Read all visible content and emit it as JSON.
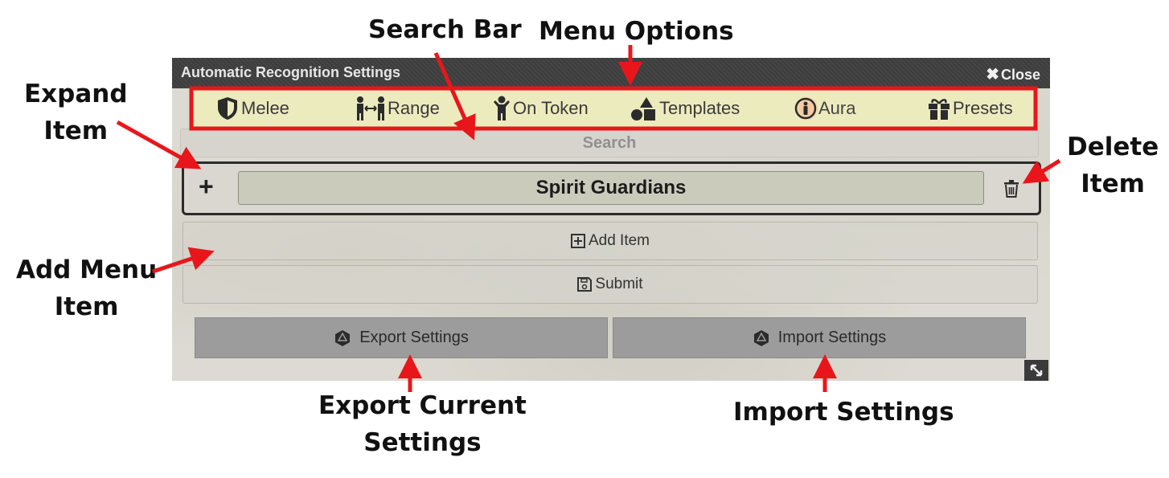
{
  "annotations": {
    "search_bar": "Search Bar",
    "menu_options": "Menu Options",
    "expand_item": "Expand\nItem",
    "delete_item": "Delete\nItem",
    "add_menu_item": "Add Menu\nItem",
    "export_current_settings": "Export Current\nSettings",
    "import_settings": "Import Settings"
  },
  "dialog": {
    "title": "Automatic Recognition Settings",
    "close_label": "Close",
    "menu": [
      {
        "label": "Melee",
        "icon": "shield-icon"
      },
      {
        "label": "Range",
        "icon": "range-icon"
      },
      {
        "label": "On Token",
        "icon": "person-icon"
      },
      {
        "label": "Templates",
        "icon": "shapes-icon"
      },
      {
        "label": "Aura",
        "icon": "aura-person-icon",
        "active": true
      },
      {
        "label": "Presets",
        "icon": "gift-icon"
      }
    ],
    "search_placeholder": "Search",
    "item": {
      "expand_symbol": "+",
      "name": "Spirit Guardians"
    },
    "add_item_label": "Add Item",
    "submit_label": "Submit",
    "export_label": "Export Settings",
    "import_label": "Import Settings"
  },
  "colors": {
    "annotation_red": "#e8161b",
    "menu_bar": "#ecebbd",
    "titlebar": "#404040",
    "gray_button": "#9c9c9c"
  }
}
